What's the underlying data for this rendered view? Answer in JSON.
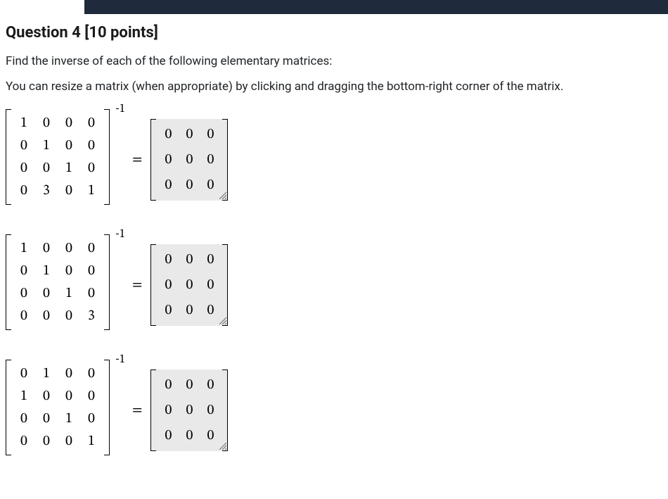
{
  "question": {
    "title": "Question 4 [10 points]",
    "prompt": "Find the inverse of each of the following elementary matrices:",
    "hint": "You can resize a matrix (when appropriate) by clicking and dragging the bottom-right corner of the matrix.",
    "exponent_label": "-1",
    "equals_label": "="
  },
  "problems": [
    {
      "given_matrix": [
        [
          1,
          0,
          0,
          0
        ],
        [
          0,
          1,
          0,
          0
        ],
        [
          0,
          0,
          1,
          0
        ],
        [
          0,
          3,
          0,
          1
        ]
      ],
      "answer_matrix": [
        [
          0,
          0,
          0
        ],
        [
          0,
          0,
          0
        ],
        [
          0,
          0,
          0
        ]
      ]
    },
    {
      "given_matrix": [
        [
          1,
          0,
          0,
          0
        ],
        [
          0,
          1,
          0,
          0
        ],
        [
          0,
          0,
          1,
          0
        ],
        [
          0,
          0,
          0,
          3
        ]
      ],
      "answer_matrix": [
        [
          0,
          0,
          0
        ],
        [
          0,
          0,
          0
        ],
        [
          0,
          0,
          0
        ]
      ]
    },
    {
      "given_matrix": [
        [
          0,
          1,
          0,
          0
        ],
        [
          1,
          0,
          0,
          0
        ],
        [
          0,
          0,
          1,
          0
        ],
        [
          0,
          0,
          0,
          1
        ]
      ],
      "answer_matrix": [
        [
          0,
          0,
          0
        ],
        [
          0,
          0,
          0
        ],
        [
          0,
          0,
          0
        ]
      ]
    }
  ]
}
